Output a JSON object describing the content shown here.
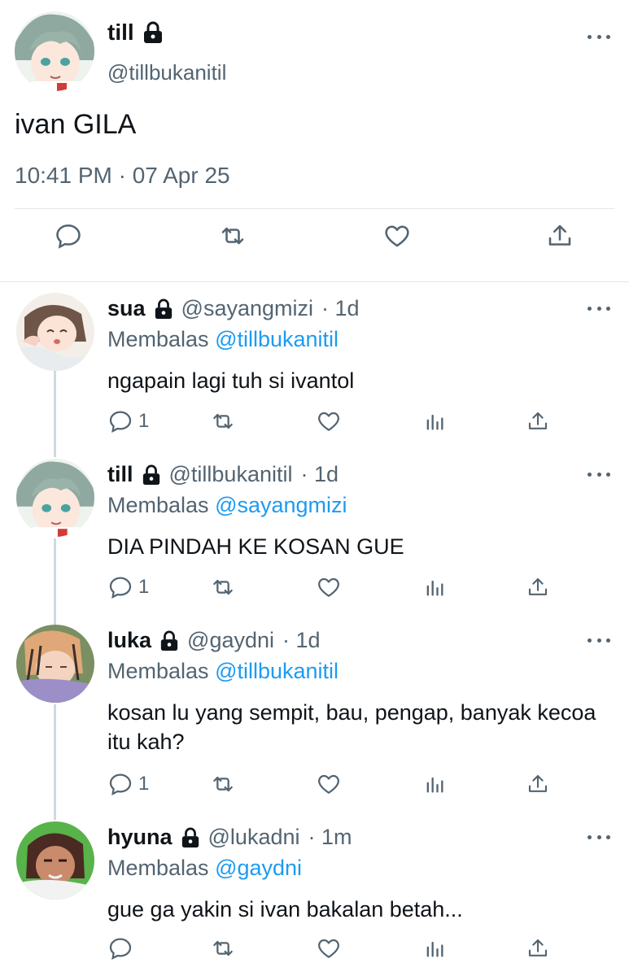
{
  "main_tweet": {
    "name": "till",
    "handle": "@tillbukanitil",
    "text": "ivan GILA",
    "timestamp": "10:41 PM · 07 Apr 25"
  },
  "replies": [
    {
      "name": "sua",
      "handle": "@sayangmizi",
      "time": "· 1d",
      "replying_label": "Membalas",
      "replying_to": "@tillbukanitil",
      "text": "ngapain lagi tuh si ivantol",
      "reply_count": "1"
    },
    {
      "name": "till",
      "handle": "@tillbukanitil",
      "time": "· 1d",
      "replying_label": "Membalas",
      "replying_to": "@sayangmizi",
      "text": "DIA PINDAH KE KOSAN GUE",
      "reply_count": "1"
    },
    {
      "name": "luka",
      "handle": "@gaydni",
      "time": "· 1d",
      "replying_label": "Membalas",
      "replying_to": "@tillbukanitil",
      "text": "kosan lu yang sempit, bau, pengap, banyak kecoa itu kah?",
      "reply_count": "1"
    },
    {
      "name": "hyuna",
      "handle": "@lukadni",
      "time": "· 1m",
      "replying_label": "Membalas",
      "replying_to": "@gaydni",
      "text": "gue ga yakin si ivan bakalan betah...",
      "reply_count": ""
    }
  ],
  "icons": {
    "reply": "reply-icon",
    "retweet": "retweet-icon",
    "like": "like-icon",
    "share": "share-icon",
    "analytics": "analytics-icon",
    "more": "more-icon",
    "lock": "lock-icon"
  },
  "colors": {
    "text": "#0f1419",
    "secondary": "#536471",
    "mention": "#1d9bf0",
    "divider": "#e1e8ed",
    "thread_line": "#cfd9de"
  }
}
